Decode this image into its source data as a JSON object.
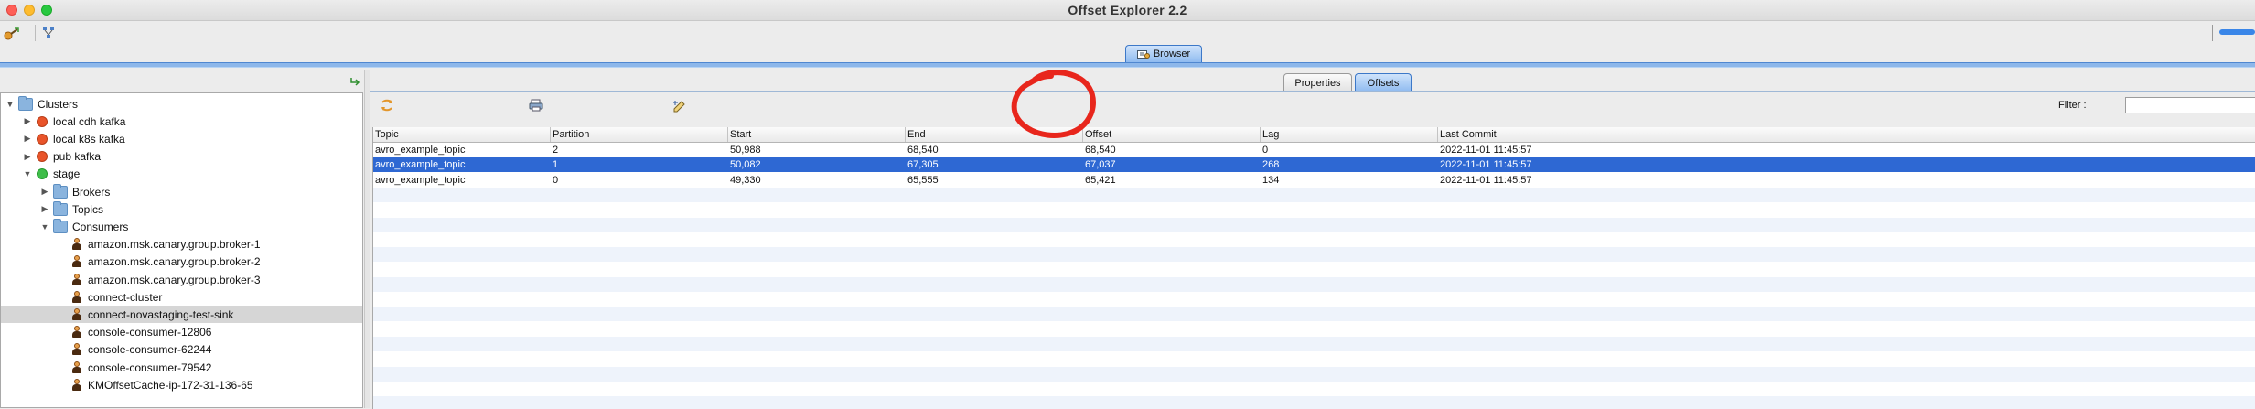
{
  "app": {
    "title": "Offset Explorer  2.2"
  },
  "main_tab": {
    "label": "Browser"
  },
  "tree": {
    "items": [
      {
        "label": "Clusters",
        "depth": 0,
        "expand": "open",
        "icon": "folder-icon"
      },
      {
        "label": "local cdh kafka",
        "depth": 1,
        "expand": "closed",
        "icon": "cluster-offline-icon"
      },
      {
        "label": "local k8s kafka",
        "depth": 1,
        "expand": "closed",
        "icon": "cluster-offline-icon"
      },
      {
        "label": "pub kafka",
        "depth": 1,
        "expand": "closed",
        "icon": "cluster-offline-icon"
      },
      {
        "label": "stage",
        "depth": 1,
        "expand": "open",
        "icon": "cluster-online-icon"
      },
      {
        "label": "Brokers",
        "depth": 2,
        "expand": "closed",
        "icon": "folder-icon"
      },
      {
        "label": "Topics",
        "depth": 2,
        "expand": "closed",
        "icon": "folder-icon"
      },
      {
        "label": "Consumers",
        "depth": 2,
        "expand": "open",
        "icon": "folder-icon"
      },
      {
        "label": "amazon.msk.canary.group.broker-1",
        "depth": 3,
        "expand": "none",
        "icon": "consumer-icon"
      },
      {
        "label": "amazon.msk.canary.group.broker-2",
        "depth": 3,
        "expand": "none",
        "icon": "consumer-icon"
      },
      {
        "label": "amazon.msk.canary.group.broker-3",
        "depth": 3,
        "expand": "none",
        "icon": "consumer-icon"
      },
      {
        "label": "connect-cluster",
        "depth": 3,
        "expand": "none",
        "icon": "consumer-icon"
      },
      {
        "label": "connect-novastaging-test-sink",
        "depth": 3,
        "expand": "none",
        "icon": "consumer-icon",
        "selected": true
      },
      {
        "label": "console-consumer-12806",
        "depth": 3,
        "expand": "none",
        "icon": "consumer-icon"
      },
      {
        "label": "console-consumer-62244",
        "depth": 3,
        "expand": "none",
        "icon": "consumer-icon"
      },
      {
        "label": "console-consumer-79542",
        "depth": 3,
        "expand": "none",
        "icon": "consumer-icon"
      },
      {
        "label": "KMOffsetCache-ip-172-31-136-65",
        "depth": 3,
        "expand": "none",
        "icon": "consumer-icon"
      }
    ]
  },
  "detail_tabs": {
    "properties": "Properties",
    "offsets": "Offsets"
  },
  "filter": {
    "label": "Filter :",
    "value": ""
  },
  "offsets_table": {
    "columns": [
      "Topic",
      "Partition",
      "Start",
      "End",
      "Offset",
      "Lag",
      "Last Commit"
    ],
    "rows": [
      [
        "avro_example_topic",
        "2",
        "50,988",
        "68,540",
        "68,540",
        "0",
        "2022-11-01 11:45:57"
      ],
      [
        "avro_example_topic",
        "1",
        "50,082",
        "67,305",
        "67,037",
        "268",
        "2022-11-01 11:45:57"
      ],
      [
        "avro_example_topic",
        "0",
        "49,330",
        "65,555",
        "65,421",
        "134",
        "2022-11-01 11:45:57"
      ]
    ],
    "selected_row": 1
  },
  "annotation": {
    "shape": "hand-drawn circle",
    "color": "#e8261c"
  },
  "colors": {
    "selection": "#2e68d3",
    "accent": "#8fbbf0"
  }
}
